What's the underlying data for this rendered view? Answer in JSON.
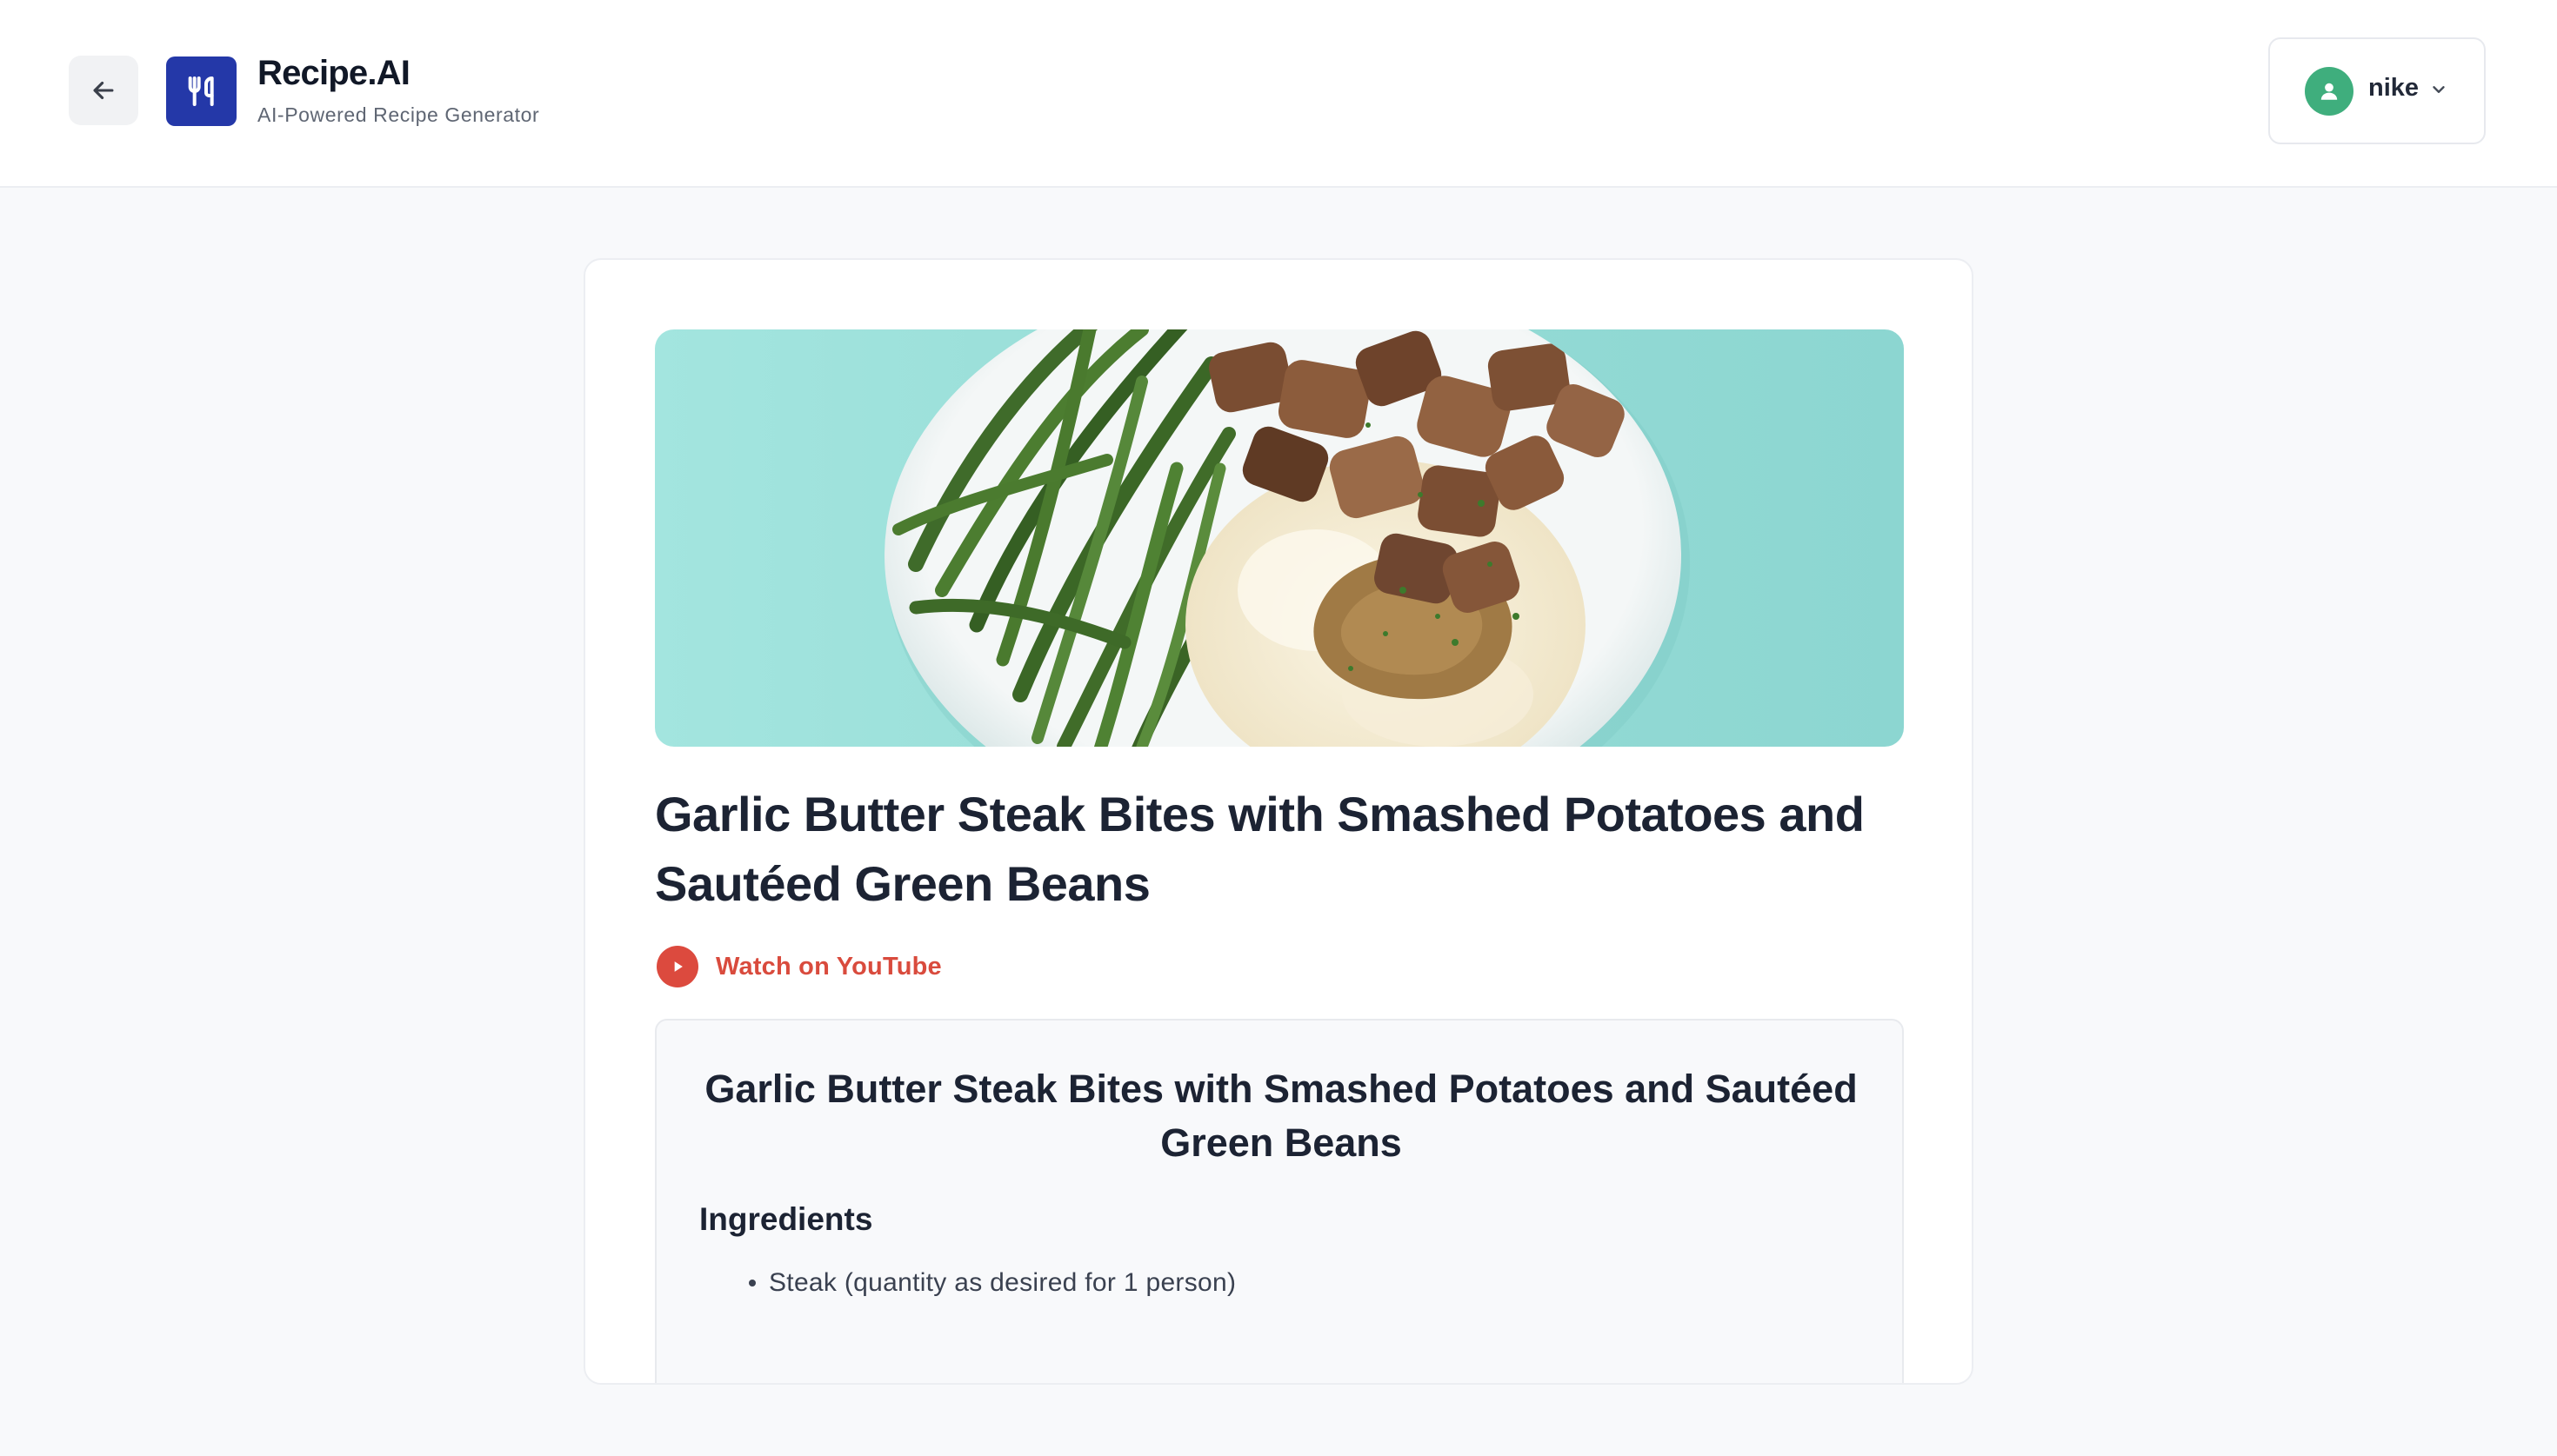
{
  "header": {
    "back_label": "Back",
    "brand_title": "Recipe.AI",
    "brand_subtitle": "AI-Powered Recipe Generator",
    "user_name": "nike"
  },
  "recipe": {
    "title": "Garlic Butter Steak Bites with Smashed Potatoes and Sautéed Green Beans",
    "youtube_label": "Watch on YouTube",
    "content_title": "Garlic Butter Steak Bites with Smashed Potatoes and Sautéed Green Beans",
    "ingredients_heading": "Ingredients",
    "ingredients": [
      "Steak (quantity as desired for 1 person)"
    ]
  },
  "colors": {
    "brand": "#2438a8",
    "avatar": "#3fae7d",
    "youtube": "#dc4a3e",
    "hero_background": "#94dcd6"
  },
  "icons": {
    "back": "arrow-left-icon",
    "logo": "fork-knife-icon",
    "avatar": "user-icon",
    "dropdown": "chevron-down-icon",
    "youtube": "play-icon"
  }
}
